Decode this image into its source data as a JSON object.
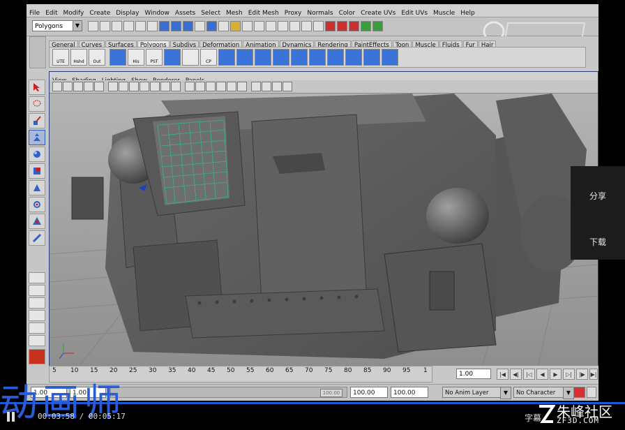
{
  "menubar": [
    "File",
    "Edit",
    "Modify",
    "Create",
    "Display",
    "Window",
    "Assets",
    "Select",
    "Mesh",
    "Edit Mesh",
    "Proxy",
    "Normals",
    "Color",
    "Create UVs",
    "Edit UVs",
    "Muscle",
    "Help"
  ],
  "status_line": {
    "mode": "Polygons"
  },
  "shelf": {
    "tabs": [
      "General",
      "Curves",
      "Surfaces",
      "Polygons",
      "Subdivs",
      "Deformation",
      "Animation",
      "Dynamics",
      "Rendering",
      "PaintEffects",
      "Toon",
      "Muscle",
      "Fluids",
      "Fur",
      "Hair"
    ],
    "active_tab": "Polygons",
    "buttons": [
      "UTE",
      "Hshd",
      "Out",
      "",
      "His",
      "PST",
      "",
      "CP",
      "",
      "",
      "",
      "",
      "",
      "",
      "",
      ""
    ]
  },
  "panel_menu": [
    "View",
    "Shading",
    "Lighting",
    "Show",
    "Renderer",
    "Panels"
  ],
  "timeline": {
    "ticks": [
      "5",
      "10",
      "15",
      "20",
      "25",
      "30",
      "35",
      "40",
      "45",
      "50",
      "55",
      "60",
      "65",
      "70",
      "75",
      "80",
      "85",
      "90",
      "95",
      "1"
    ],
    "current_frame": "1.00"
  },
  "range_slider": {
    "start": "1.00",
    "playback_start": "1.00",
    "playback_end": "100.00",
    "end": "100.00",
    "handle_label": "100.00",
    "anim_layer": "No Anim Layer",
    "character_set": "No Character Set"
  },
  "side_panel": {
    "share": "分享",
    "download": "下载"
  },
  "video_overlay": {
    "title": "动画师",
    "timecode": "00:03:58 / 00:05:17",
    "subtitle_button": "字幕",
    "brand_name": "朱峰社区",
    "brand_url": "ZF3D.COM"
  },
  "colors": {
    "maya_bg": "#c8c8c8",
    "viewport_frame": "#2a3a7a",
    "overlay_blue": "#2a5cd8",
    "progress": "#1a5ad8"
  }
}
